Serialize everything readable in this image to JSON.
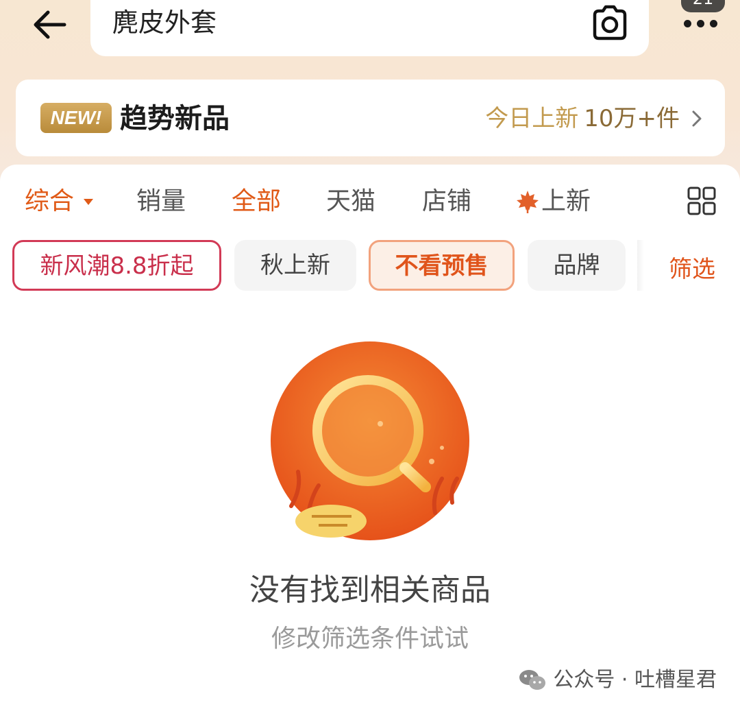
{
  "header": {
    "search_text": "麂皮外套",
    "badge": "21",
    "icons": {
      "back": "back-arrow-icon",
      "camera": "camera-icon",
      "more": "more-dots-icon"
    }
  },
  "trend": {
    "tag": "NEW!",
    "title": "趋势新品",
    "today_label": "今日上新",
    "count": "10万+件",
    "icon": "chevron-right-icon"
  },
  "sort_tabs": [
    {
      "label": "综合",
      "active": true
    },
    {
      "label": "销量",
      "active": false
    },
    {
      "label": "全部",
      "active": true
    },
    {
      "label": "天猫",
      "active": false
    },
    {
      "label": "店铺",
      "active": false
    },
    {
      "label": "上新",
      "active": false,
      "icon": "maple-leaf-icon"
    }
  ],
  "layout_toggle_icon": "grid-view-icon",
  "filter_chips": [
    {
      "label": "新风潮8.8折起",
      "style": "outlined-red"
    },
    {
      "label": "秋上新",
      "style": "grey"
    },
    {
      "label": "不看预售",
      "style": "selected-orange"
    },
    {
      "label": "品牌",
      "style": "grey"
    }
  ],
  "filter_button": "筛选",
  "empty_state": {
    "title": "没有找到相关商品",
    "subtitle": "修改筛选条件试试",
    "icon": "magnifier-illustration-icon"
  },
  "watermark": "公众号 · 吐槽星君",
  "colors": {
    "accent": "#e05a17",
    "promo_red": "#c92f4b",
    "gold": "#c29a4e"
  }
}
